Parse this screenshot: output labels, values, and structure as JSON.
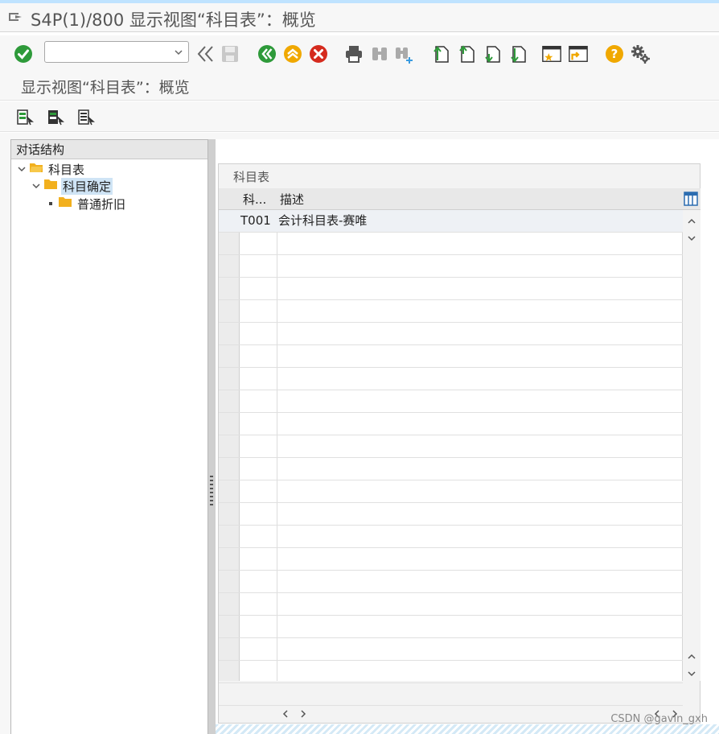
{
  "window": {
    "title": "S4P(1)/800 显示视图“科目表”：概览"
  },
  "toolbar": {
    "command_field_value": "",
    "icons": [
      "enter-icon",
      "command-dropdown-icon",
      "collapse-toolbar-icon",
      "save-icon",
      "back-icon",
      "exit-icon",
      "cancel-icon",
      "print-icon",
      "find-icon",
      "find-next-icon",
      "first-page-icon",
      "previous-page-icon",
      "next-page-icon",
      "last-page-icon",
      "create-session-icon",
      "create-shortcut-icon",
      "help-icon",
      "customize-layout-icon"
    ]
  },
  "screen": {
    "title": "显示视图“科目表”：概览"
  },
  "app_toolbar": {
    "icons": [
      "select-all-icon",
      "select-block-icon",
      "deselect-all-icon"
    ]
  },
  "tree": {
    "header": "对话结构",
    "nodes": [
      {
        "label": "科目表",
        "level": 0,
        "expanded": true,
        "selected": false
      },
      {
        "label": "科目确定",
        "level": 1,
        "expanded": true,
        "selected": true
      },
      {
        "label": "普通折旧",
        "level": 2,
        "expanded": false,
        "selected": false
      }
    ]
  },
  "table": {
    "title": "科目表",
    "columns": [
      "科...",
      "描述"
    ],
    "rows": [
      {
        "code": "T001",
        "description": "会计科目表-赛唯"
      }
    ],
    "empty_rows": 21
  },
  "colors": {
    "accent_green": "#2e9a3a",
    "accent_orange": "#f0a800",
    "accent_red": "#d52b1e",
    "selection": "#cfe4f5",
    "folder": "#f2b01e"
  },
  "watermark": "CSDN @gavin_gxh"
}
